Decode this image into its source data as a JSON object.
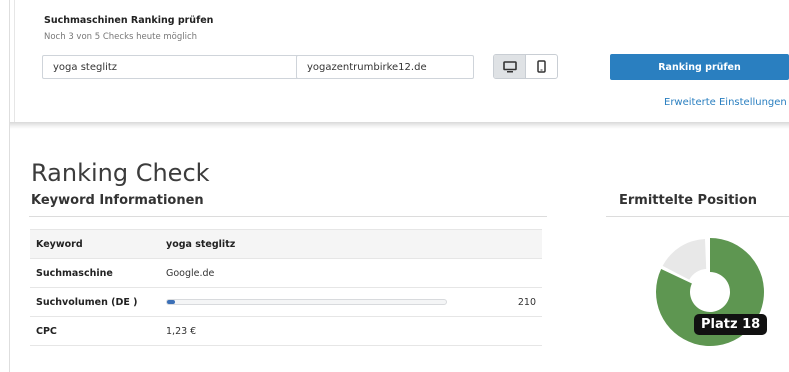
{
  "check_form": {
    "title": "Suchmaschinen Ranking prüfen",
    "subtitle": "Noch 3 von 5 Checks heute möglich",
    "keyword_value": "yoga steglitz",
    "domain_value": "yogazentrumbirke12.de",
    "device_options": [
      "desktop-icon",
      "mobile-icon"
    ],
    "device_selected": "desktop",
    "submit_label": "Ranking prüfen",
    "advanced_link": "Erweiterte Einstellungen"
  },
  "ranking": {
    "title": "Ranking Check",
    "keyword_section": "Keyword Informationen",
    "position_section": "Ermittelte Position",
    "rows": {
      "keyword": {
        "label": "Keyword",
        "value": "yoga steglitz"
      },
      "engine": {
        "label": "Suchmaschine",
        "value": "Google.de"
      },
      "volume": {
        "label": "Suchvolumen (DE )",
        "value": "210",
        "bar_fraction": 0.01
      },
      "cpc": {
        "label": "CPC",
        "value": "1,23 €"
      }
    },
    "position_label": "Platz 18",
    "position_fraction": 0.82
  },
  "colors": {
    "accent": "#2a7fc0",
    "donut_main": "#5e9651",
    "donut_rest": "#e8e8e8",
    "volume_bar": "#3b6fb6"
  }
}
